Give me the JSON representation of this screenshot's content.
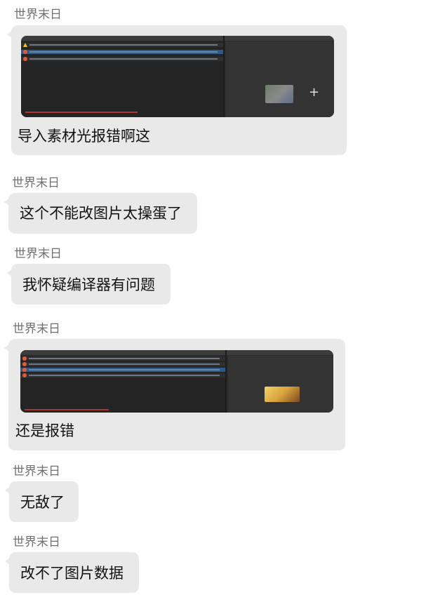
{
  "messages": [
    {
      "sender": "世界末日",
      "text": "导入素材光报错啊这",
      "has_image": true
    },
    {
      "sender": "世界末日",
      "text": "这个不能改图片太操蛋了"
    },
    {
      "sender": "世界末日",
      "text": "我怀疑编译器有问题"
    },
    {
      "sender": "世界末日",
      "text": "还是报错",
      "has_image": true
    },
    {
      "sender": "世界末日",
      "text": "无敌了"
    },
    {
      "sender": "世界末日",
      "text": "改不了图片数据"
    }
  ],
  "colors": {
    "bubble": "#e9e9e9",
    "sender": "#707070",
    "editor_bg": "#2b2b2b",
    "error": "#e05a3a",
    "warning": "#f0c020",
    "selection": "#2c5a8a"
  },
  "icons": [
    "error-icon",
    "warning-icon",
    "plus-icon"
  ]
}
